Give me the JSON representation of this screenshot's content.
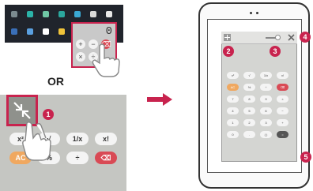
{
  "qslide": {
    "display_value": "0",
    "keys": [
      "+",
      "−",
      "⌫",
      "×",
      "÷"
    ]
  },
  "separator": {
    "or_label": "OR"
  },
  "shrink": {
    "badge": "1",
    "keys": [
      "x²",
      "√",
      "1/x",
      "x!",
      "AC",
      "%",
      "÷",
      "⌫"
    ]
  },
  "tablet": {
    "badges": [
      "2",
      "3",
      "4",
      "5"
    ],
    "key_rows": [
      [
        "x²",
        "√",
        "1/x",
        "x!"
      ],
      [
        "AC",
        "%",
        "÷",
        "⌫"
      ],
      [
        "7",
        "8",
        "9",
        "×"
      ],
      [
        "4",
        "5",
        "6",
        "−"
      ],
      [
        "1",
        "2",
        "3",
        "+"
      ],
      [
        "0",
        ".",
        "( )",
        "="
      ]
    ]
  },
  "colors": {
    "accent": "#c8234e",
    "delete_key": "#d94a55",
    "ac_key": "#f0a860"
  }
}
